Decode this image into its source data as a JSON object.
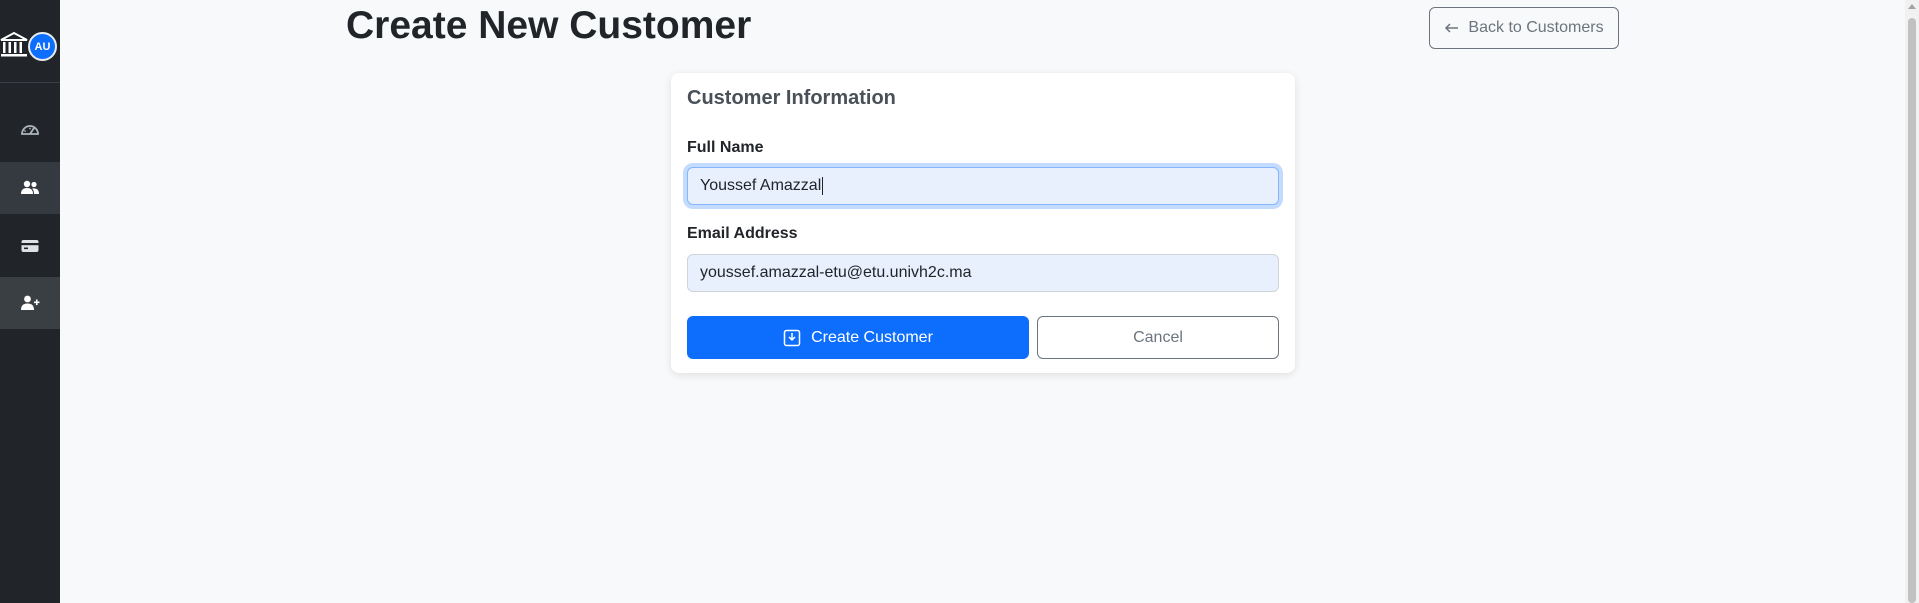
{
  "sidebar": {
    "avatar_initials": "AU",
    "icons": [
      "bank-icon",
      "dashboard-icon",
      "customers-icon",
      "accounts-card-icon",
      "add-user-icon"
    ]
  },
  "header": {
    "title": "Create New Customer",
    "back_button": "Back to Customers"
  },
  "form": {
    "card_title": "Customer Information",
    "full_name_label": "Full Name",
    "full_name_value": "Youssef Amazzal",
    "email_label": "Email Address",
    "email_value": "youssef.amazzal-etu@etu.univh2c.ma",
    "submit_label": "Create Customer",
    "cancel_label": "Cancel"
  },
  "colors": {
    "primary": "#0d6efd",
    "sidebar_bg": "#212529",
    "page_bg": "#f8f9fa",
    "autofill_bg": "#e8f0fe"
  }
}
